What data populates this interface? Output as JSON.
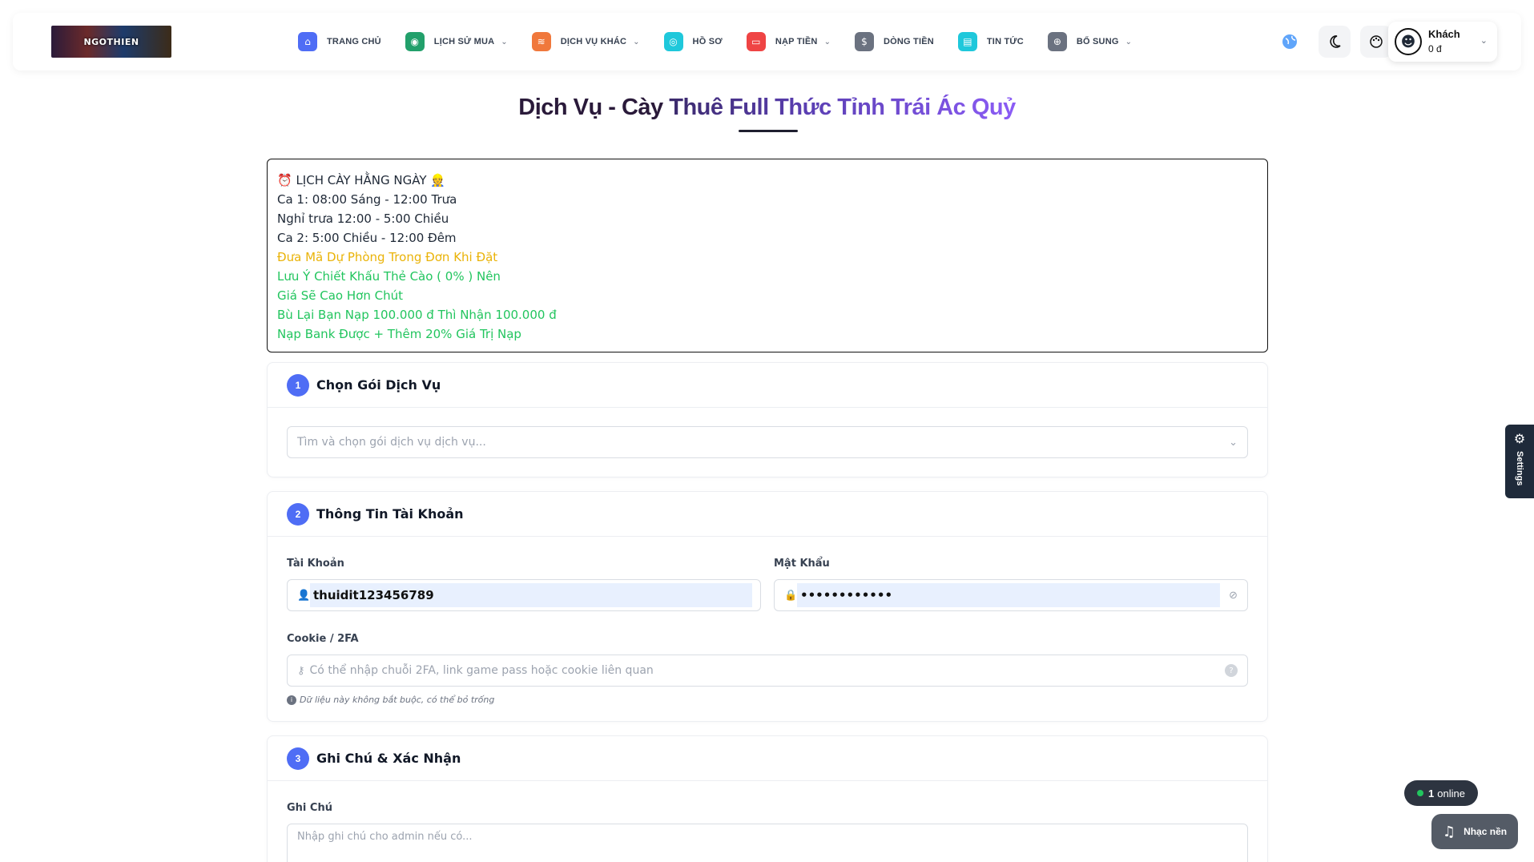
{
  "header": {
    "logo_text": "NGOTHIEN",
    "nav": [
      {
        "label": "TRANG CHỦ",
        "icon": "home-icon",
        "color": "#4f6df5",
        "dropdown": false
      },
      {
        "label": "LỊCH SỬ MUA",
        "icon": "gamepad-icon",
        "color": "#22a06b",
        "dropdown": true
      },
      {
        "label": "DỊCH VỤ KHÁC",
        "icon": "layers-icon",
        "color": "#f0783c",
        "dropdown": true
      },
      {
        "label": "HỒ SƠ",
        "icon": "profile-icon",
        "color": "#1fc8db",
        "dropdown": false
      },
      {
        "label": "NẠP TIỀN",
        "icon": "wallet-icon",
        "color": "#ef4444",
        "dropdown": true
      },
      {
        "label": "DÒNG TIỀN",
        "icon": "dollar-icon",
        "color": "#6b7280",
        "dropdown": false
      },
      {
        "label": "TIN TỨC",
        "icon": "news-icon",
        "color": "#1fc8db",
        "dropdown": false
      },
      {
        "label": "BỔ SUNG",
        "icon": "plus-circle-icon",
        "color": "#6b7280",
        "dropdown": true
      }
    ],
    "user": {
      "name": "Khách",
      "balance": "0 đ"
    }
  },
  "title": {
    "part1": "Dịch Vụ - Cày",
    "part2": "Thuê Full Thức Tỉnh Trái Ác Quỷ"
  },
  "notice": {
    "heading": "⏰ LỊCH CÀY HẰNG NGÀY 👷",
    "lines": [
      {
        "text": "Ca 1: 08:00 Sáng - 12:00 Trưa",
        "color": "dark"
      },
      {
        "text": "Nghỉ trưa 12:00 - 5:00 Chiều",
        "color": "dark"
      },
      {
        "text": "Ca 2: 5:00 Chiều - 12:00 Đêm",
        "color": "dark"
      },
      {
        "text": "Đưa Mã Dự Phòng Trong Đơn Khi Đặt",
        "color": "yellow"
      },
      {
        "text": "Lưu Ý Chiết Khấu Thẻ Cào ( 0% ) Nên",
        "color": "green"
      },
      {
        "text": "Giá Sẽ Cao Hơn Chút",
        "color": "green"
      },
      {
        "text": "Bù Lại Bạn Nạp 100.000 đ Thì Nhận 100.000 đ",
        "color": "green"
      },
      {
        "text": "Nạp Bank Được + Thêm 20% Giá Trị Nạp",
        "color": "green"
      }
    ]
  },
  "step1": {
    "num": "1",
    "title": "Chọn Gói Dịch Vụ",
    "select_placeholder": "Tìm và chọn gói dịch vụ dịch vụ..."
  },
  "step2": {
    "num": "2",
    "title": "Thông Tin Tài Khoản",
    "account_label": "Tài Khoản",
    "account_value": "thuidit123456789",
    "password_label": "Mật Khẩu",
    "password_value": "••••••••••••",
    "cookie_label": "Cookie / 2FA",
    "cookie_placeholder": "Có thể nhập chuỗi 2FA, link game pass hoặc cookie liên quan",
    "cookie_hint": "Dữ liệu này không bắt buộc, có thể bỏ trống"
  },
  "step3": {
    "num": "3",
    "title": "Ghi Chú & Xác Nhận",
    "note_label": "Ghi Chú",
    "note_placeholder": "Nhập ghi chú cho admin nếu có..."
  },
  "floating": {
    "settings_label": "Settings",
    "online_count": "1",
    "online_text": "online",
    "music_label": "Nhạc nền"
  }
}
